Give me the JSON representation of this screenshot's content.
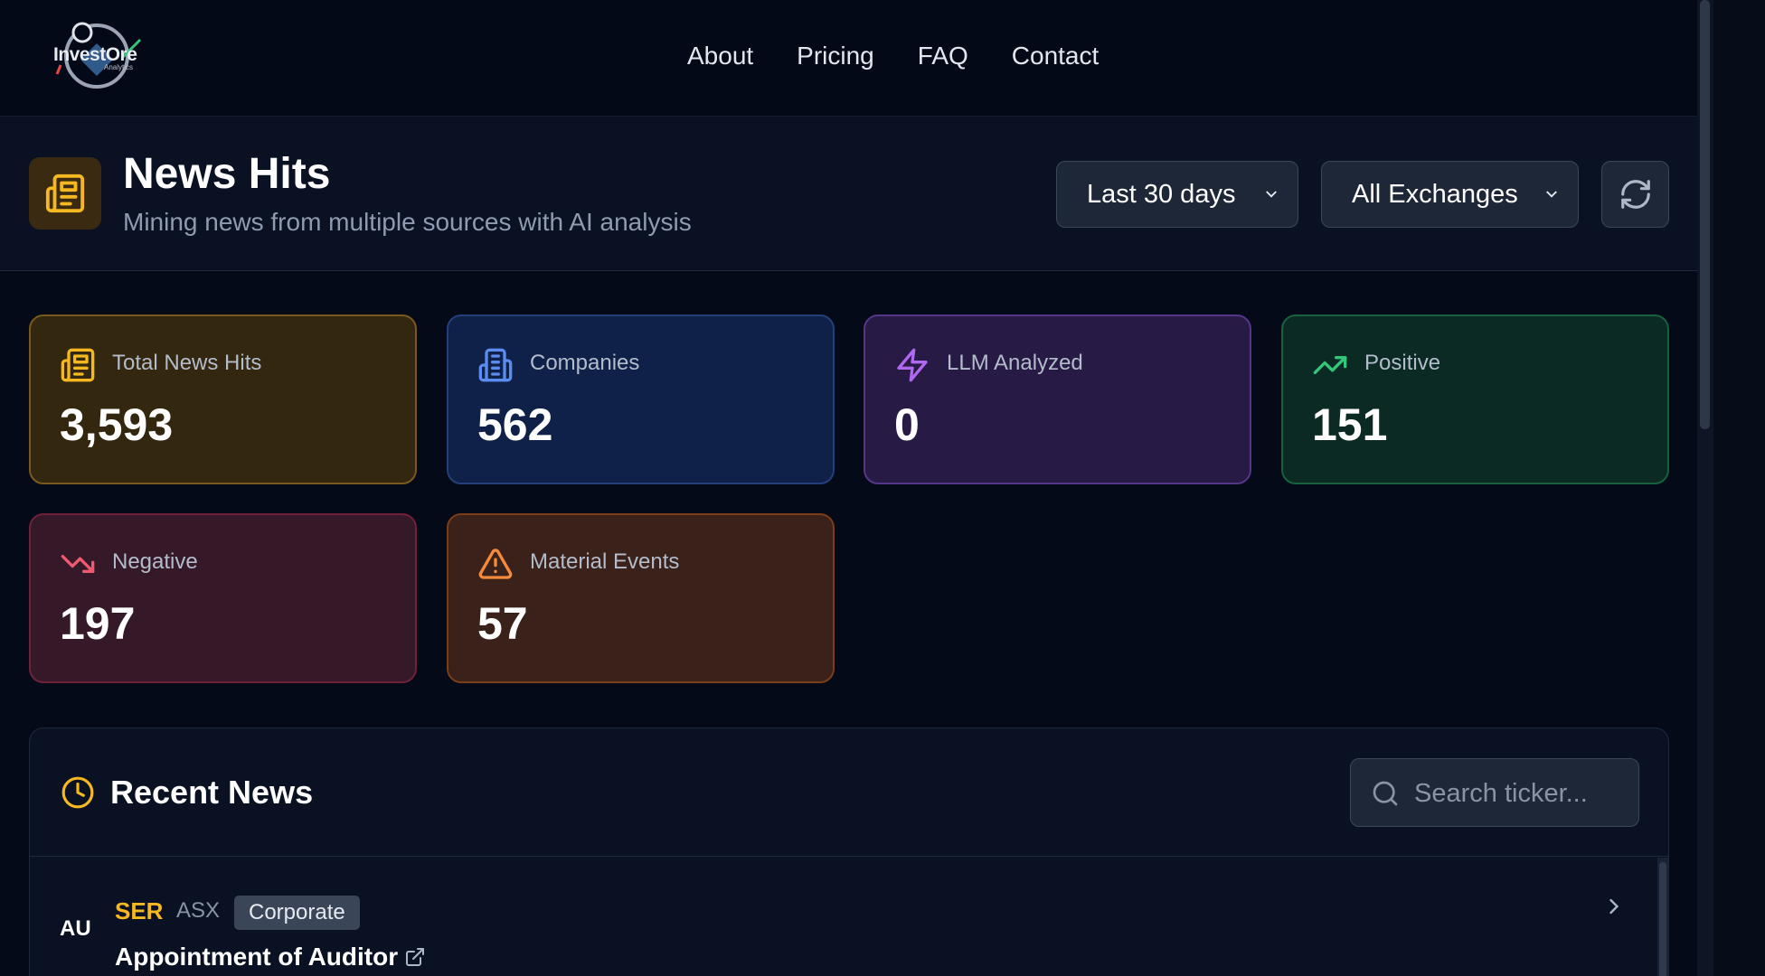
{
  "nav": {
    "logo": {
      "brand": "InvestOre",
      "sub": "Analytics"
    },
    "links": [
      "About",
      "Pricing",
      "FAQ",
      "Contact"
    ]
  },
  "header": {
    "title": "News Hits",
    "subtitle": "Mining news from multiple sources with AI analysis",
    "period_select": "Last 30 days",
    "exchange_select": "All Exchanges"
  },
  "stats": [
    {
      "label": "Total News Hits",
      "value": "3,593",
      "icon": "newspaper-icon",
      "color": "#f5b820"
    },
    {
      "label": "Companies",
      "value": "562",
      "icon": "building-icon",
      "color": "#5b8def"
    },
    {
      "label": "LLM Analyzed",
      "value": "0",
      "icon": "lightning-icon",
      "color": "#b068f0"
    },
    {
      "label": "Positive",
      "value": "151",
      "icon": "trending-up-icon",
      "color": "#34c77a"
    },
    {
      "label": "Negative",
      "value": "197",
      "icon": "trending-down-icon",
      "color": "#ef5a6f"
    },
    {
      "label": "Material Events",
      "value": "57",
      "icon": "warning-icon",
      "color": "#f58a3a"
    }
  ],
  "recent": {
    "title": "Recent News",
    "search_placeholder": "Search ticker...",
    "items": [
      {
        "country": "AU",
        "ticker": "SER",
        "exchange": "ASX",
        "category": "Corporate",
        "headline": "Appointment of Auditor"
      }
    ]
  }
}
